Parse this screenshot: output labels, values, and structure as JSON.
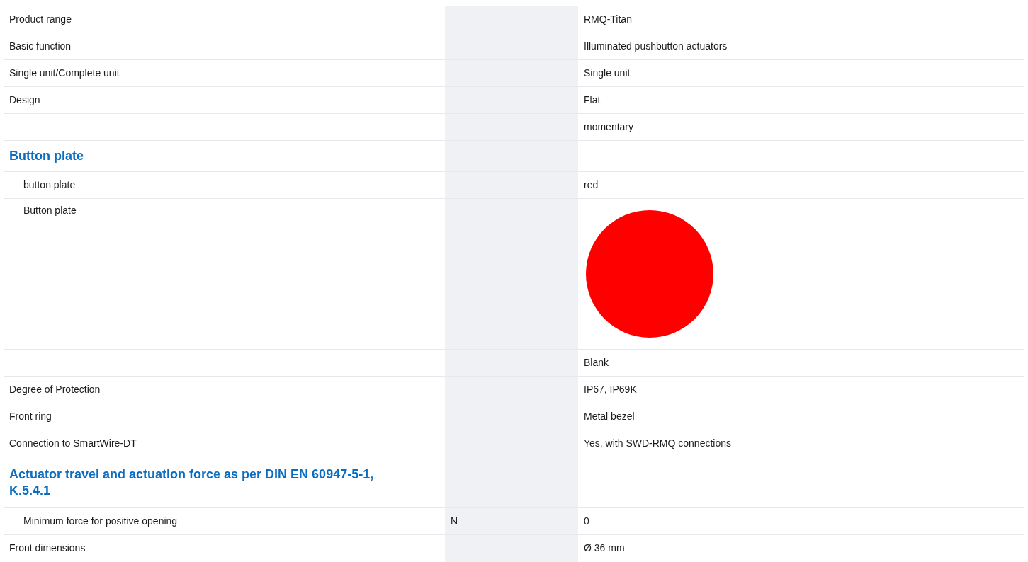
{
  "rows": [
    {
      "kind": "row",
      "label": "Product range",
      "value": "RMQ-Titan"
    },
    {
      "kind": "row",
      "label": "Basic function",
      "value": "Illuminated pushbutton actuators"
    },
    {
      "kind": "row",
      "label": "Single unit/Complete unit",
      "value": "Single unit"
    },
    {
      "kind": "row",
      "label": "Design",
      "value": "Flat"
    },
    {
      "kind": "row",
      "value": "momentary"
    },
    {
      "kind": "heading",
      "label": "Button plate",
      "children": [
        {
          "kind": "row",
          "label": "button plate",
          "value": "red"
        },
        {
          "kind": "swatch",
          "label": "Button plate",
          "color": "#ff0000"
        }
      ]
    },
    {
      "kind": "row",
      "value": "Blank"
    },
    {
      "kind": "row",
      "label": "Degree of Protection",
      "value": "IP67, IP69K"
    },
    {
      "kind": "row",
      "label": "Front ring",
      "value": "Metal bezel"
    },
    {
      "kind": "row",
      "label": "Connection to SmartWire-DT",
      "value": "Yes, with SWD-RMQ connections"
    },
    {
      "kind": "heading",
      "label": "Actuator travel and actuation force as per DIN EN 60947-5-1, K.5.4.1",
      "children": [
        {
          "kind": "row",
          "label": "Minimum force for positive opening",
          "unit": "N",
          "value": "0"
        }
      ]
    },
    {
      "kind": "row",
      "label": "Front dimensions",
      "value": "Ø 36 mm"
    }
  ]
}
